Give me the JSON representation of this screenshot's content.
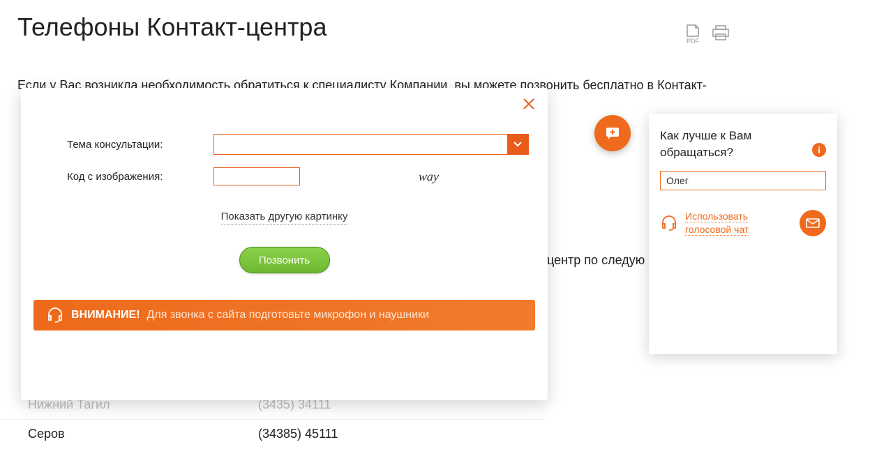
{
  "header": {
    "title": "Телефоны Контакт-центра",
    "pdf_label": "PDF"
  },
  "intro": "Если у Вас возникла необходимость обратиться к специалисту Компании, вы можете позвонить бесплатно в Контакт-",
  "suffix": "-центр по следую",
  "table": {
    "rows": [
      {
        "city": "Нижний Тагил",
        "phone": "(3435) 34111"
      },
      {
        "city": "Серов",
        "phone": "(34385) 45111"
      }
    ]
  },
  "modal": {
    "topic_label": "Тема консультации:",
    "captcha_label": "Код с изображения:",
    "captcha_text": "way",
    "refresh_link": "Показать другую картинку",
    "call_btn": "Позвонить",
    "warn_label": "ВНИМАНИЕ!",
    "warn_text": "Для звонка с сайта подготовьте микрофон и наушники"
  },
  "chat": {
    "title": "Как лучше к Вам обращаться?",
    "name_value": "Олег",
    "voice_line1": "Использовать",
    "voice_line2": "голосовой чат"
  }
}
